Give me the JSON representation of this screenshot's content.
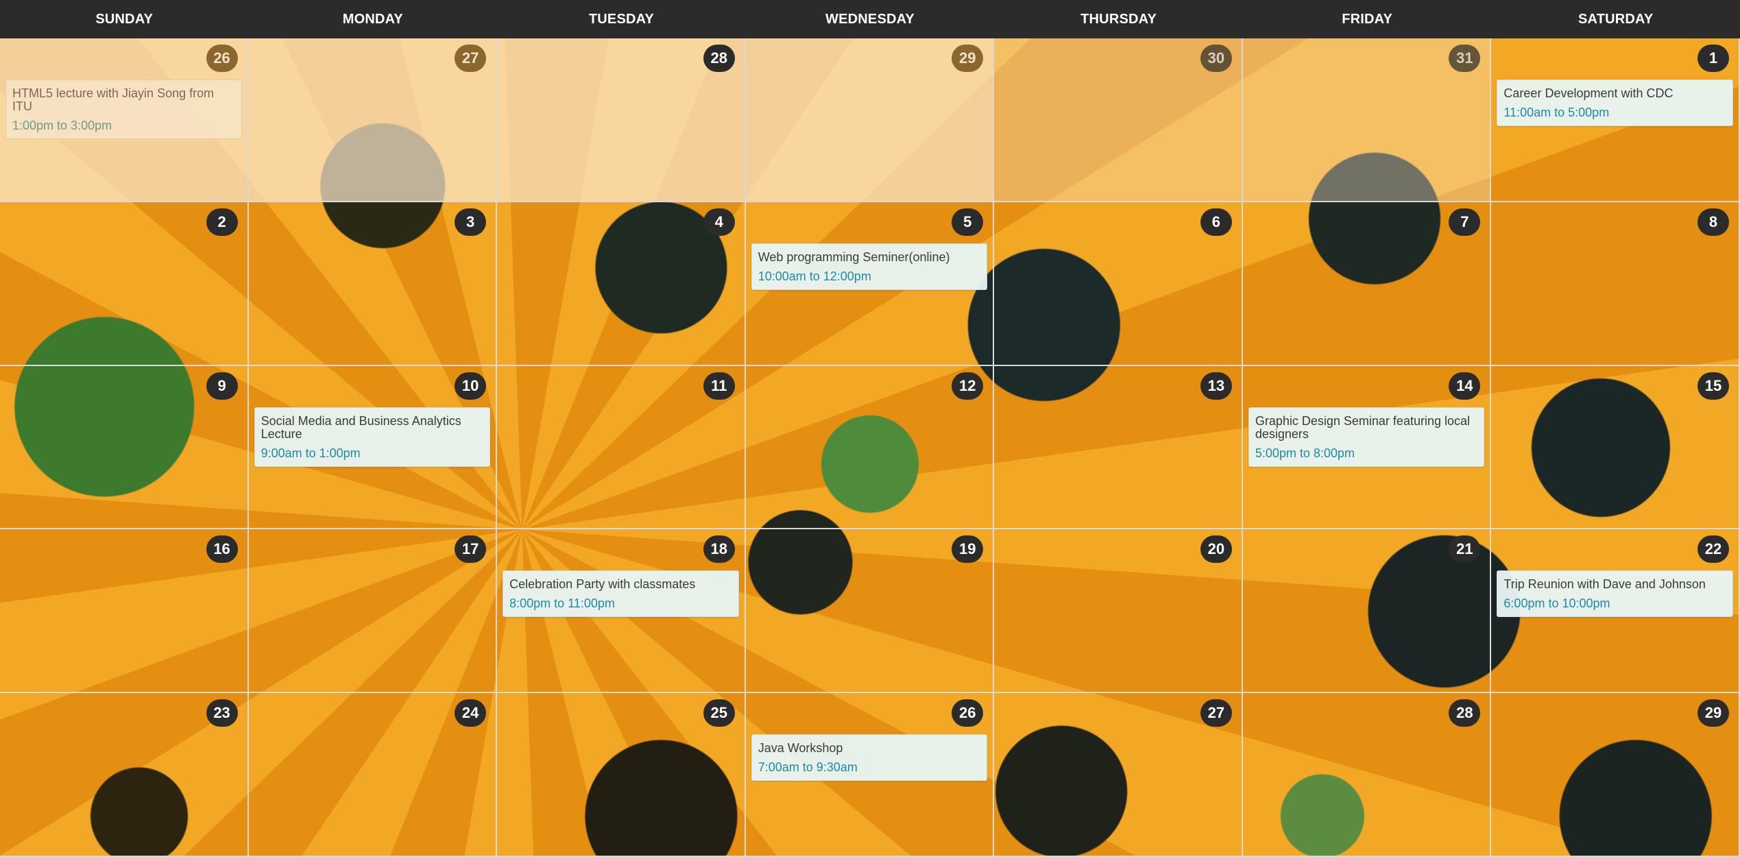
{
  "weekdays": [
    "SUNDAY",
    "MONDAY",
    "TUESDAY",
    "WEDNESDAY",
    "THURSDAY",
    "FRIDAY",
    "SATURDAY"
  ],
  "days": [
    {
      "num": "26",
      "prev_month": true
    },
    {
      "num": "27",
      "prev_month": true
    },
    {
      "num": "28",
      "prev_month": true
    },
    {
      "num": "29",
      "prev_month": true
    },
    {
      "num": "30",
      "prev_month": true
    },
    {
      "num": "31",
      "prev_month": true
    },
    {
      "num": "1"
    },
    {
      "num": "2"
    },
    {
      "num": "3"
    },
    {
      "num": "4"
    },
    {
      "num": "5"
    },
    {
      "num": "6"
    },
    {
      "num": "7"
    },
    {
      "num": "8"
    },
    {
      "num": "9"
    },
    {
      "num": "10"
    },
    {
      "num": "11"
    },
    {
      "num": "12"
    },
    {
      "num": "13"
    },
    {
      "num": "14"
    },
    {
      "num": "15"
    },
    {
      "num": "16"
    },
    {
      "num": "17"
    },
    {
      "num": "18"
    },
    {
      "num": "19"
    },
    {
      "num": "20"
    },
    {
      "num": "21"
    },
    {
      "num": "22"
    },
    {
      "num": "23"
    },
    {
      "num": "24"
    },
    {
      "num": "25"
    },
    {
      "num": "26"
    },
    {
      "num": "27"
    },
    {
      "num": "28"
    },
    {
      "num": "29"
    }
  ],
  "events": {
    "0": {
      "title": "HTML5 lecture with Jiayin Song from ITU",
      "time": "1:00pm to 3:00pm"
    },
    "6": {
      "title": "Career Development with CDC",
      "time": "11:00am to 5:00pm"
    },
    "10": {
      "title": "Web programming Seminer(online)",
      "time": "10:00am to 12:00pm"
    },
    "15": {
      "title": "Social Media and Business Analytics Lecture",
      "time": "9:00am to 1:00pm"
    },
    "19": {
      "title": "Graphic Design Seminar featuring local designers",
      "time": "5:00pm to 8:00pm"
    },
    "23": {
      "title": "Celebration Party with classmates",
      "time": "8:00pm to 11:00pm"
    },
    "27": {
      "title": "Trip Reunion with Dave and Johnson",
      "time": "6:00pm to 10:00pm"
    },
    "31": {
      "title": "Java Workshop",
      "time": "7:00am to 9:30am"
    }
  }
}
